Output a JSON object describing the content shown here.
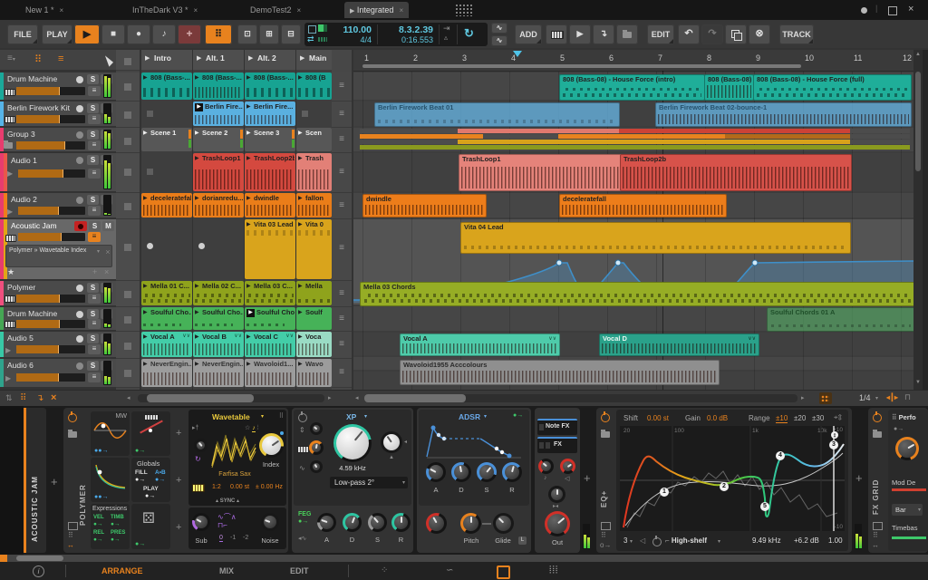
{
  "tabs": {
    "items": [
      "New 1 *",
      "InTheDark V3 *",
      "DemoTest2",
      "Integrated"
    ],
    "close": "×",
    "active_marker": "▶"
  },
  "toolbar": {
    "file": "FILE",
    "play": "PLAY",
    "add": "ADD",
    "edit": "EDIT",
    "track": "TRACK"
  },
  "transport": {
    "tempo": "110.00",
    "timesig": "4/4",
    "position": "8.3.2.39",
    "time": "0:16.553"
  },
  "launcher": {
    "scenes": [
      "Intro",
      "Alt. 1",
      "Alt. 2",
      "Main"
    ],
    "rows": [
      [
        "808 (Bass-...",
        "808 (Bass-...",
        "808 (Bass-...",
        "808 (B"
      ],
      [
        "",
        "Berlin Fire...",
        "Berlin Fire...",
        ""
      ],
      [
        "Scene 1",
        "Scene 2",
        "Scene 3",
        "Scen"
      ],
      [
        "",
        "TrashLoop1",
        "TrashLoop2b",
        "Trash"
      ],
      [
        "deceleratefall",
        "dorianredu...",
        "dwindle",
        "fallon"
      ],
      [
        "",
        "",
        "Vita 03 Lead",
        "Vita 0"
      ],
      [
        "Mella 01 C...",
        "Mella 02 C...",
        "Mella 03 C...",
        "Mella"
      ],
      [
        "Soulful Cho...",
        "Soulful Cho...",
        "Soulful Cho...",
        "Soulf"
      ],
      [
        "Vocal A",
        "Vocal B",
        "Vocal C",
        "Voca"
      ],
      [
        "NeverEngin...",
        "NeverEngin...",
        "Wavoloid1...",
        "Wavo"
      ]
    ]
  },
  "tracks": {
    "solo": "S",
    "mute": "M",
    "items": [
      {
        "name": "Drum Machine"
      },
      {
        "name": "Berlin Firework Kit"
      },
      {
        "name": "Group 3"
      },
      {
        "name": "Audio 1"
      },
      {
        "name": "Audio 2"
      },
      {
        "name": "Acoustic Jam"
      },
      {
        "name": "Polymer"
      },
      {
        "name": "Drum Machine"
      },
      {
        "name": "Audio 5"
      },
      {
        "name": "Audio 6"
      }
    ],
    "automation_lane": {
      "param": "Polymer » Wavetable Index"
    }
  },
  "arranger": {
    "ruler": [
      "1",
      "2",
      "3",
      "4",
      "5",
      "6",
      "7",
      "8",
      "9",
      "10",
      "11",
      "12"
    ],
    "clips": {
      "t1": [
        "808 (Bass-08) - House Force (intro)",
        "808 (Bass-08)",
        "808 (Bass-08) - House Force (full)"
      ],
      "t2": [
        "Berlin Firework Beat 01",
        "Berlin Firework Beat 02-bounce-1"
      ],
      "t4": [
        "TrashLoop1",
        "TrashLoop2b"
      ],
      "t5": [
        "dwindle",
        "deceleratefall"
      ],
      "t6": [
        "Vita 04 Lead"
      ],
      "t7": [
        "Mella 03 Chords"
      ],
      "t8": [
        "Soulful Chords 01 A"
      ],
      "t9": [
        "Vocal A",
        "Vocal D"
      ],
      "t10": [
        "Wavoloid1955 Acccolours"
      ]
    },
    "snap": "1/4"
  },
  "devices": {
    "track": "ACOUSTIC JAM",
    "polymer": {
      "name": "POLYMER",
      "mw": "MW",
      "globals": "Globals",
      "fill": "FILL",
      "ab": "A•B",
      "play": "PLAY",
      "expressions": "Expressions",
      "vel": "VEL",
      "timb": "TIMB",
      "rel": "REL",
      "pres": "PRES",
      "wavetable": {
        "title": "Wavetable",
        "wave": "Farfisa Sax",
        "index": "Index",
        "ratio": "1:2",
        "detune": "0.00 st",
        "hz": "± 0.00 Hz",
        "sync": "SYNC"
      },
      "sub": "Sub",
      "octaves": [
        "0",
        "-1",
        "-2"
      ],
      "noise": "Noise"
    },
    "xp": {
      "title": "XP",
      "freq": "4.59 kHz",
      "mode": "Low-pass 2°",
      "feg": "FEG",
      "env": [
        "A",
        "D",
        "S",
        "R"
      ]
    },
    "adsr": {
      "title": "ADSR",
      "env": [
        "A",
        "D",
        "S",
        "R"
      ],
      "pitch": "Pitch",
      "glide": "Glide"
    },
    "outsec": {
      "notefx": "Note FX",
      "fx": "FX",
      "out": "Out"
    },
    "eq": {
      "name": "EQ+",
      "shift_label": "Shift",
      "shift": "0.00 st",
      "gain_label": "Gain",
      "gain": "0.0 dB",
      "range_label": "Range",
      "ranges": [
        "±10",
        "±20",
        "±30"
      ],
      "freqs": [
        "20",
        "100",
        "1k",
        "10k"
      ],
      "db_hi": "+10",
      "db_lo": "-10",
      "bands": [
        "1",
        "2",
        "3",
        "4",
        "5"
      ],
      "band_count": "3",
      "band_type": "High-shelf",
      "band_freq": "9.49 kHz",
      "band_gain": "+6.2 dB",
      "band_q": "1.00"
    },
    "fxgrid": {
      "name": "FX GRID",
      "panel": "Perfo",
      "mod_label": "Mod De",
      "bar": "Bar",
      "timebase": "Timebas"
    }
  },
  "statusbar": {
    "arrange": "ARRANGE",
    "mix": "MIX",
    "edit": "EDIT"
  },
  "colors": {
    "accent": "#e8821e",
    "display_cyan": "#5fc8e0",
    "track_colors": [
      "#1ba99a",
      "#56b4e8",
      "#e83c6e",
      "#e8584a",
      "#ee7d1c",
      "#e2a517",
      "#ef4f7e",
      "#45a654",
      "#38c8a6",
      "#2fa38c"
    ]
  }
}
